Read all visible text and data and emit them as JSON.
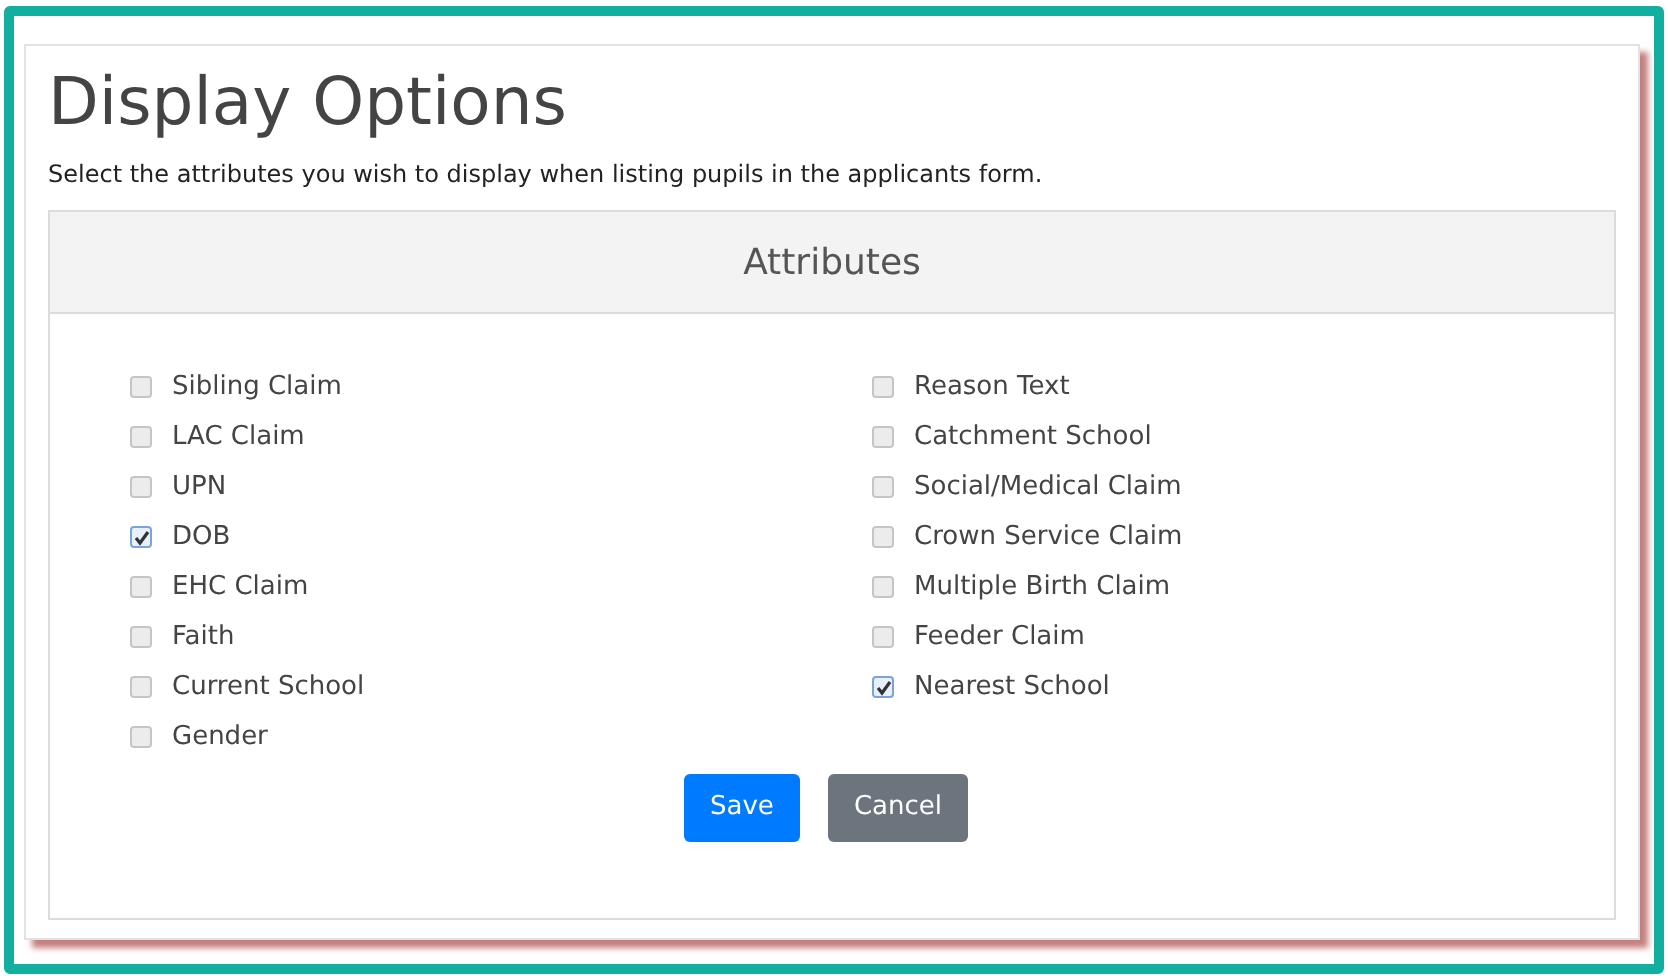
{
  "title": "Display Options",
  "description": "Select the attributes you wish to display when listing pupils in the applicants form.",
  "card": {
    "header": "Attributes",
    "columns": [
      [
        {
          "label": "Sibling Claim",
          "checked": false
        },
        {
          "label": "LAC Claim",
          "checked": false
        },
        {
          "label": "UPN",
          "checked": false
        },
        {
          "label": "DOB",
          "checked": true
        },
        {
          "label": "EHC Claim",
          "checked": false
        },
        {
          "label": "Faith",
          "checked": false
        },
        {
          "label": "Current School",
          "checked": false
        },
        {
          "label": "Gender",
          "checked": false
        }
      ],
      [
        {
          "label": "Reason Text",
          "checked": false
        },
        {
          "label": "Catchment School",
          "checked": false
        },
        {
          "label": "Social/Medical Claim",
          "checked": false
        },
        {
          "label": "Crown Service Claim",
          "checked": false
        },
        {
          "label": "Multiple Birth Claim",
          "checked": false
        },
        {
          "label": "Feeder Claim",
          "checked": false
        },
        {
          "label": "Nearest School",
          "checked": true
        }
      ]
    ]
  },
  "buttons": [
    {
      "label": "Save",
      "kind": "primary"
    },
    {
      "label": "Cancel",
      "kind": "secondary"
    }
  ]
}
